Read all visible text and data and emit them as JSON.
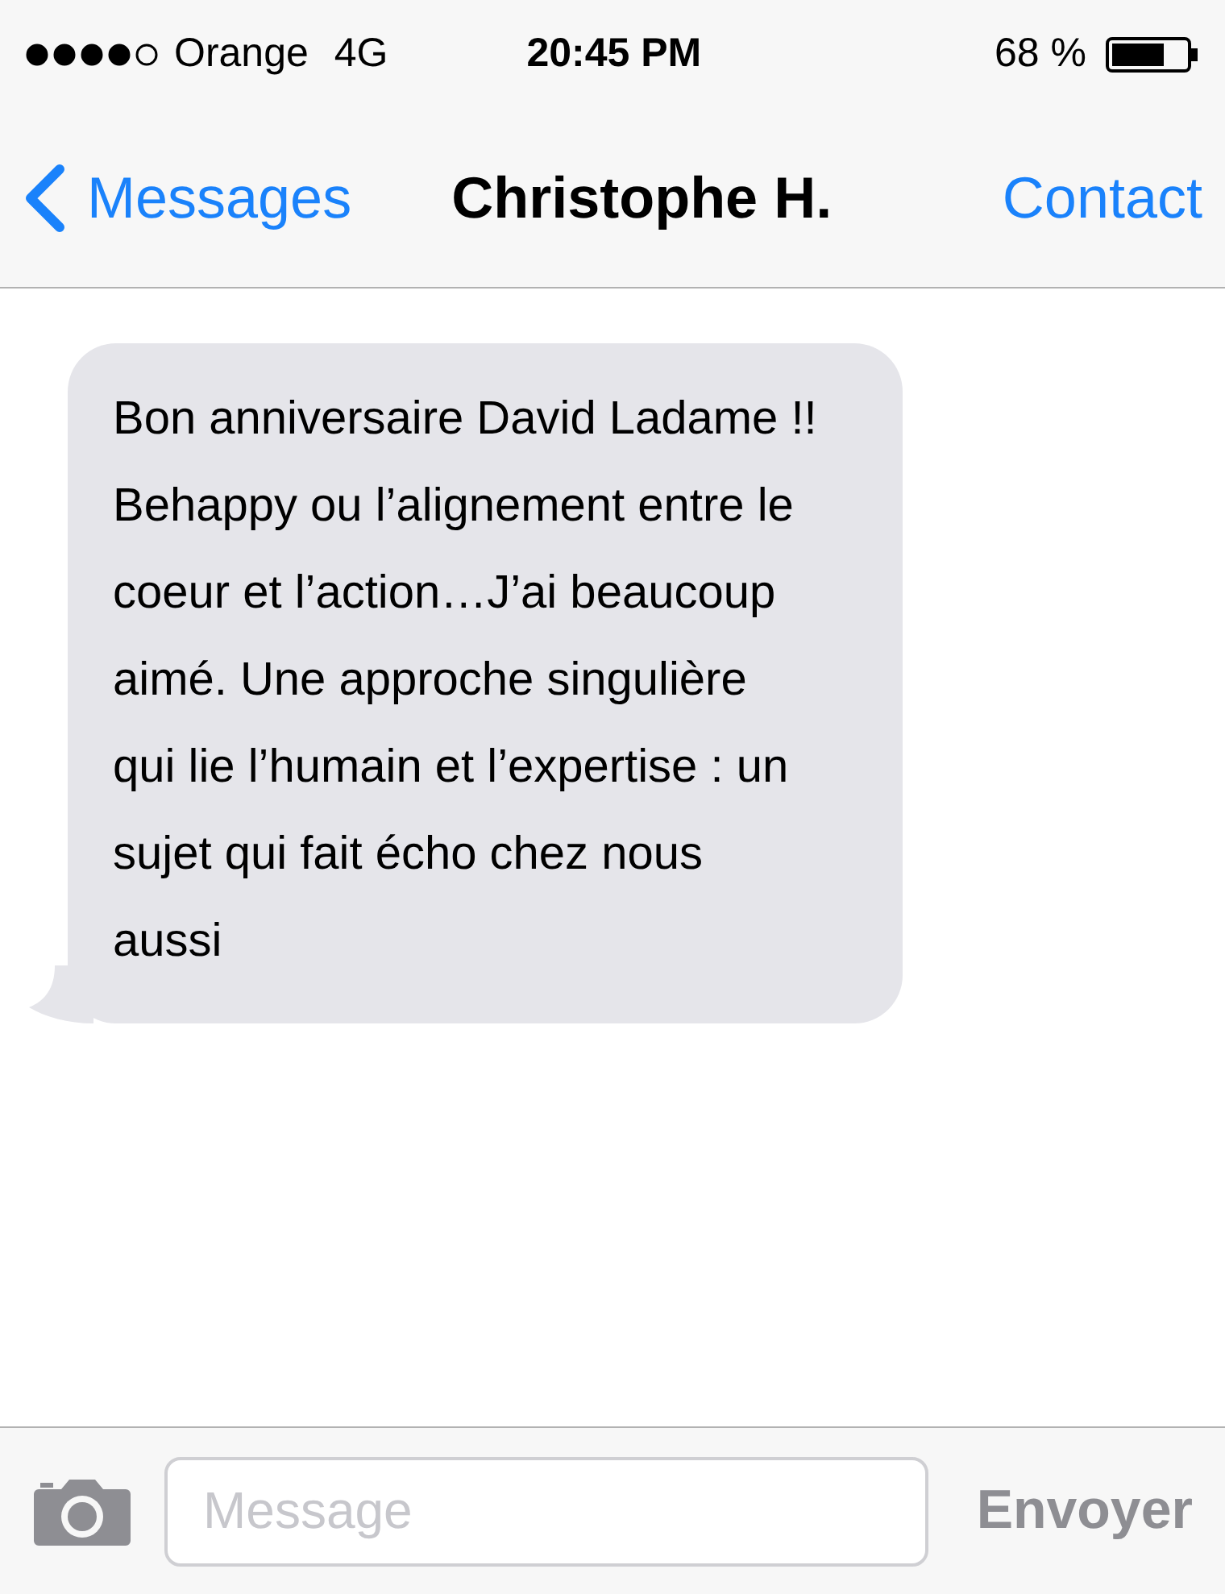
{
  "status_bar": {
    "carrier": "Orange",
    "network": "4G",
    "time": "20:45 PM",
    "battery": "68 %"
  },
  "nav": {
    "back": "Messages",
    "title": "Christophe H.",
    "action": "Contact"
  },
  "messages": [
    {
      "kind": "received",
      "text": "Bon anniversaire David Ladame !! Behappy ou l’alignement entre le coeur et l’action…J’ai beaucoup aimé. Une approche singulière qui lie l’humain et l’expertise : un sujet qui fait écho chez nous aussi"
    }
  ],
  "composer": {
    "placeholder": "Message",
    "send": "Envoyer",
    "send_disabled": true
  }
}
